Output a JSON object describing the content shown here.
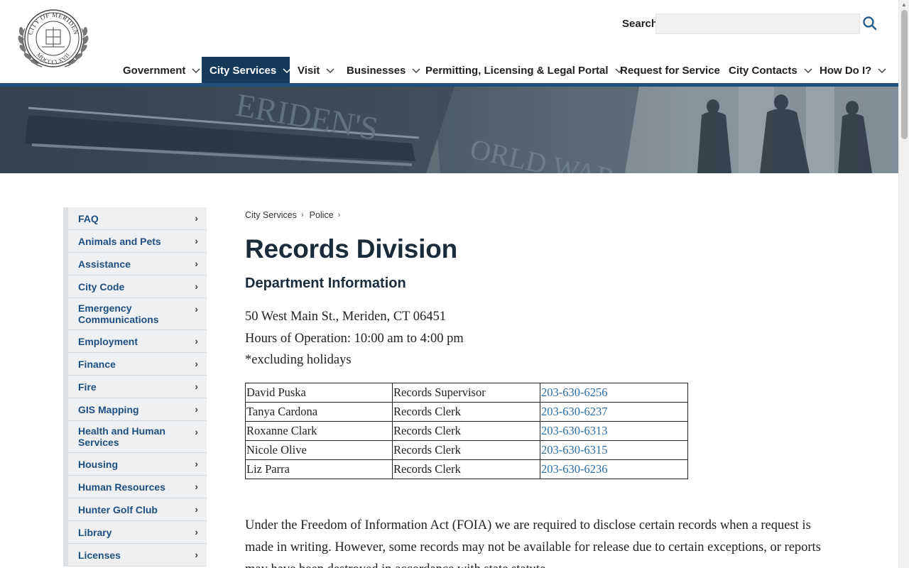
{
  "header": {
    "seal_alt": "CITY OF MERIDEN MDCCCLXVII",
    "seal_top": "CITY OF MERIDEN",
    "seal_bottom": "MDCCCLXVII",
    "search_label": "Search",
    "search_value": "",
    "search_icon": "search-icon"
  },
  "nav": {
    "items": [
      {
        "label": "Government",
        "has_dropdown": true
      },
      {
        "label": "City Services",
        "has_dropdown": true,
        "active": true
      },
      {
        "label": "Visit",
        "has_dropdown": true
      },
      {
        "label": "Businesses",
        "has_dropdown": true
      },
      {
        "label": "Permitting, Licensing & Legal Portal",
        "has_dropdown": true
      },
      {
        "label": "Request for Service",
        "has_dropdown": false
      },
      {
        "label": "City Contacts",
        "has_dropdown": true
      },
      {
        "label": "How Do I?",
        "has_dropdown": true
      }
    ]
  },
  "sidebar": {
    "items": [
      {
        "label": "FAQ"
      },
      {
        "label": "Animals and Pets"
      },
      {
        "label": "Assistance"
      },
      {
        "label": "City Code"
      },
      {
        "label": "Emergency Communications"
      },
      {
        "label": "Employment"
      },
      {
        "label": "Finance"
      },
      {
        "label": "Fire"
      },
      {
        "label": "GIS Mapping"
      },
      {
        "label": "Health and Human Services"
      },
      {
        "label": "Housing"
      },
      {
        "label": "Human Resources"
      },
      {
        "label": "Hunter Golf Club"
      },
      {
        "label": "Library"
      },
      {
        "label": "Licenses"
      }
    ]
  },
  "breadcrumb": {
    "items": [
      "City Services",
      "Police"
    ],
    "separator": "›"
  },
  "main": {
    "title": "Records Division",
    "subtitle": "Department Information",
    "address": "50 West Main St., Meriden, CT 06451",
    "hours": "Hours of Operation: 10:00 am to 4:00 pm",
    "note": "*excluding holidays",
    "staff": [
      {
        "name": "David Puska",
        "role": "Records Supervisor",
        "phone": "203-630-6256"
      },
      {
        "name": "Tanya Cardona",
        "role": "Records Clerk",
        "phone": "203-630-6237"
      },
      {
        "name": "Roxanne Clark",
        "role": "Records Clerk",
        "phone": "203-630-6313"
      },
      {
        "name": "Nicole Olive",
        "role": "Records Clerk",
        "phone": "203-630-6315"
      },
      {
        "name": "Liz Parra",
        "role": "Records Clerk",
        "phone": "203-630-6236"
      }
    ],
    "foia_text": "Under the Freedom of Information Act (FOIA) we are required to disclose certain records when a request is made in writing. However, some records may not be available for release due to certain exceptions, or reports may have been destroyed in accordance with state statute."
  },
  "colors": {
    "nav_active_bg": "#15395b",
    "nav_rule": "#1d4f7a",
    "link": "#2b6ea6",
    "sidebar_text": "#1e4f80",
    "sidebar_bg": "#eef0f1"
  }
}
